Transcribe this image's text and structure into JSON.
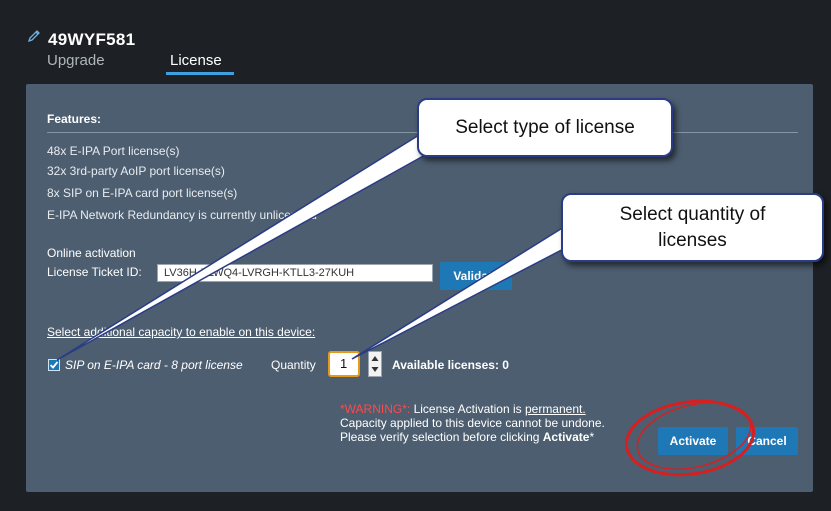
{
  "device": {
    "title": "49WYF581",
    "icon": "pencil-icon"
  },
  "tabs": [
    {
      "label": "Upgrade",
      "active": false
    },
    {
      "label": "License",
      "active": true
    }
  ],
  "features": {
    "title": "Features:",
    "items": [
      "48x E-IPA Port license(s)",
      "32x 3rd-party AoIP port license(s)",
      "8x SIP on E-IPA card port license(s)",
      "E-IPA Network Redundancy is currently unlicensed"
    ]
  },
  "online_activation": {
    "title": "Online activation",
    "ticket_label": "License Ticket ID:",
    "ticket_value": "LV36H-ELWQ4-LVRGH-KTLL3-27KUH",
    "validate_label": "Validate"
  },
  "additional": {
    "title": "Select additional capacity to enable on this device:",
    "option_label": "SIP on E-IPA card - 8 port license",
    "option_checked": true,
    "quantity_label": "Quantity",
    "quantity_value": "1",
    "available_label": "Available licenses: 0"
  },
  "warning": {
    "tag": "*WARNING*:",
    "line1_text": " License Activation is ",
    "line1_emph": "permanent.",
    "line2": "Capacity applied to this device cannot be undone.",
    "line3_text": "Please verify selection before clicking ",
    "line3_emph": "Activate",
    "line3_end": "*"
  },
  "actions": {
    "activate_label": "Activate",
    "cancel_label": "Cancel"
  },
  "annotations": {
    "callout_type": "Select type of license",
    "callout_qty_line1": "Select quantity of",
    "callout_qty_line2": "licenses"
  },
  "colors": {
    "accent": "#1f78b6",
    "panel": "#4d5e70",
    "warning": "#ff4a4a",
    "highlight": "#e59a1b",
    "circle": "#d81f1f"
  }
}
